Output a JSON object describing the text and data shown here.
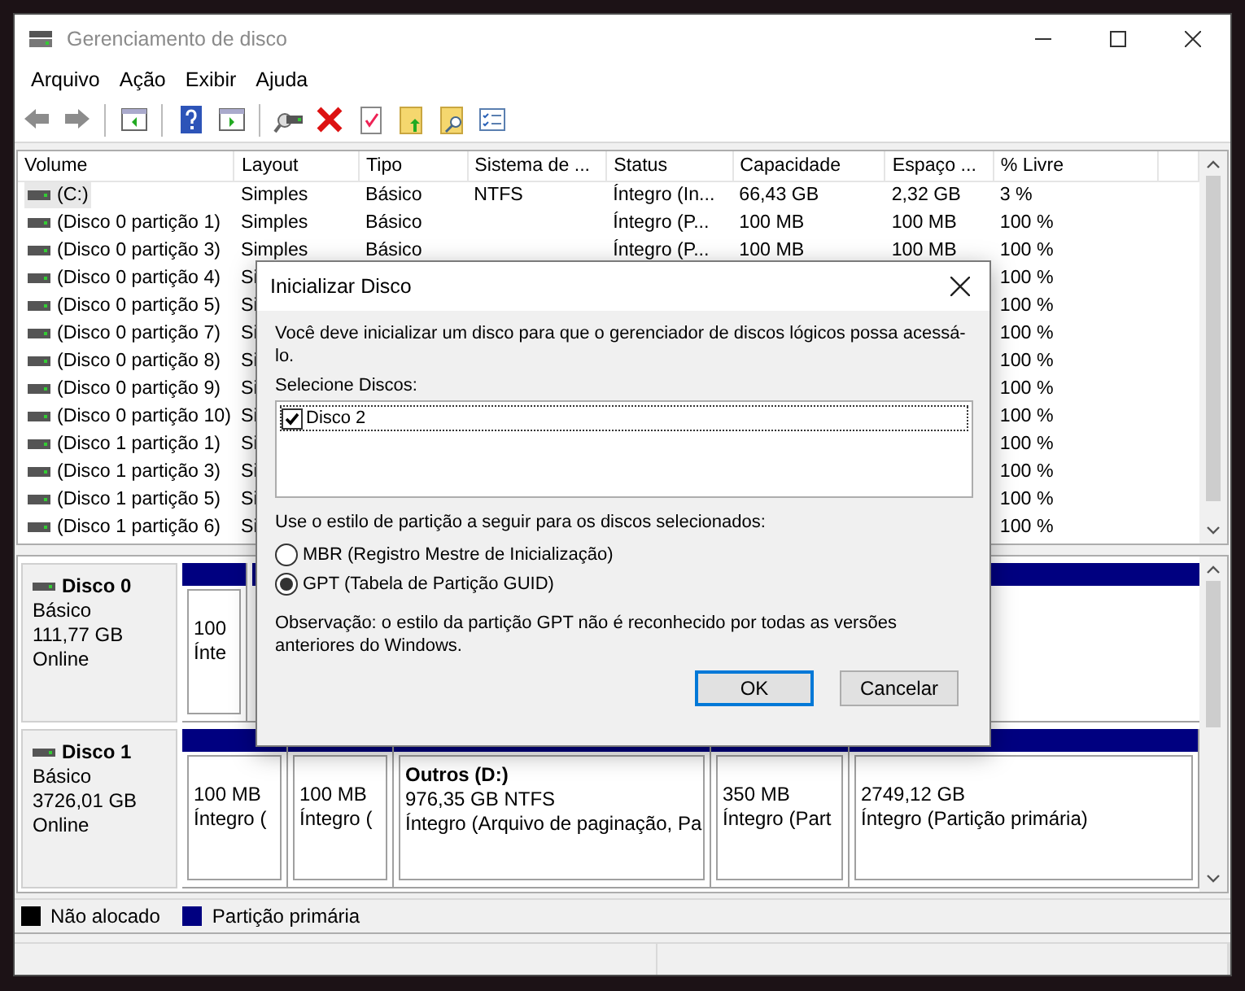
{
  "window": {
    "title": "Gerenciamento de disco"
  },
  "menu": [
    "Arquivo",
    "Ação",
    "Exibir",
    "Ajuda"
  ],
  "table": {
    "columns": [
      "Volume",
      "Layout",
      "Tipo",
      "Sistema de ...",
      "Status",
      "Capacidade",
      "Espaço ...",
      "% Livre"
    ],
    "rows": [
      {
        "volume": "(C:)",
        "selected": true,
        "layout": "Simples",
        "type": "Básico",
        "fs": "NTFS",
        "status": "Íntegro (In...",
        "capacity": "66,43 GB",
        "free": "2,32 GB",
        "pct": "3 %"
      },
      {
        "volume": "(Disco 0 partição 1)",
        "selected": false,
        "layout": "Simples",
        "type": "Básico",
        "status": "Íntegro (P...",
        "capacity": "100 MB",
        "free": "100 MB",
        "pct": "100 %"
      },
      {
        "volume": "(Disco 0 partição 3)",
        "selected": false,
        "layout": "Simples",
        "type": "Básico",
        "status": "Íntegro (P...",
        "capacity": "100 MB",
        "free": "100 MB",
        "pct": "100 %"
      },
      {
        "volume": "(Disco 0 partição 4)",
        "selected": false,
        "layout": "Si",
        "pct": "100 %"
      },
      {
        "volume": "(Disco 0 partição 5)",
        "selected": false,
        "layout": "Si",
        "pct": "100 %"
      },
      {
        "volume": "(Disco 0 partição 7)",
        "selected": false,
        "layout": "Si",
        "pct": "100 %"
      },
      {
        "volume": "(Disco 0 partição 8)",
        "selected": false,
        "layout": "Si",
        "pct": "100 %"
      },
      {
        "volume": "(Disco 0 partição 9)",
        "selected": false,
        "layout": "Si",
        "pct": "100 %"
      },
      {
        "volume": "(Disco 0 partição 10)",
        "selected": false,
        "layout": "Si",
        "pct": "100 %"
      },
      {
        "volume": "(Disco 1 partição 1)",
        "selected": false,
        "layout": "Si",
        "pct": "100 %"
      },
      {
        "volume": "(Disco 1 partição 3)",
        "selected": false,
        "layout": "Si",
        "pct": "100 %"
      },
      {
        "volume": "(Disco 1 partição 5)",
        "selected": false,
        "layout": "Si",
        "pct": "100 %"
      },
      {
        "volume": "(Disco 1 partição 6)",
        "selected": false,
        "layout": "Si",
        "pct": "100 %"
      }
    ]
  },
  "disks": [
    {
      "name": "Disco 0",
      "type": "Básico",
      "size": "111,77 GB",
      "state": "Online",
      "partitions": [
        {
          "lines": [
            "100",
            "Ínte"
          ]
        }
      ]
    },
    {
      "name": "Disco 1",
      "type": "Básico",
      "size": "3726,01 GB",
      "state": "Online",
      "partitions": [
        {
          "lines": [
            "100 MB",
            "Íntegro ("
          ]
        },
        {
          "lines": [
            "100 MB",
            "Íntegro ("
          ]
        },
        {
          "label": "Outros  (D:)",
          "lines": [
            "976,35 GB NTFS",
            "Íntegro (Arquivo de paginação, Pa"
          ]
        },
        {
          "lines": [
            "350 MB",
            "Íntegro (Part"
          ]
        },
        {
          "lines": [
            "2749,12 GB",
            "Íntegro (Partição primária)"
          ]
        }
      ]
    }
  ],
  "legend": [
    {
      "label": "Não alocado",
      "color": "#000000"
    },
    {
      "label": "Partição primária",
      "color": "#000080"
    }
  ],
  "dialog": {
    "title": "Inicializar Disco",
    "message": "Você deve inicializar um disco para que o gerenciador de discos lógicos possa acessá-lo.",
    "list_label": "Selecione Discos:",
    "disks": [
      {
        "label": "Disco 2",
        "checked": true
      }
    ],
    "style_label": "Use o estilo de partição a seguir para os discos selecionados:",
    "styles": [
      {
        "label": "MBR (Registro Mestre de Inicialização)",
        "selected": false
      },
      {
        "label": "GPT (Tabela de Partição GUID)",
        "selected": true
      }
    ],
    "note": "Observação: o estilo da partição GPT não é reconhecido por todas as versões anteriores do Windows.",
    "buttons": [
      {
        "label": "OK",
        "default": true
      },
      {
        "label": "Cancelar",
        "default": false
      }
    ]
  }
}
